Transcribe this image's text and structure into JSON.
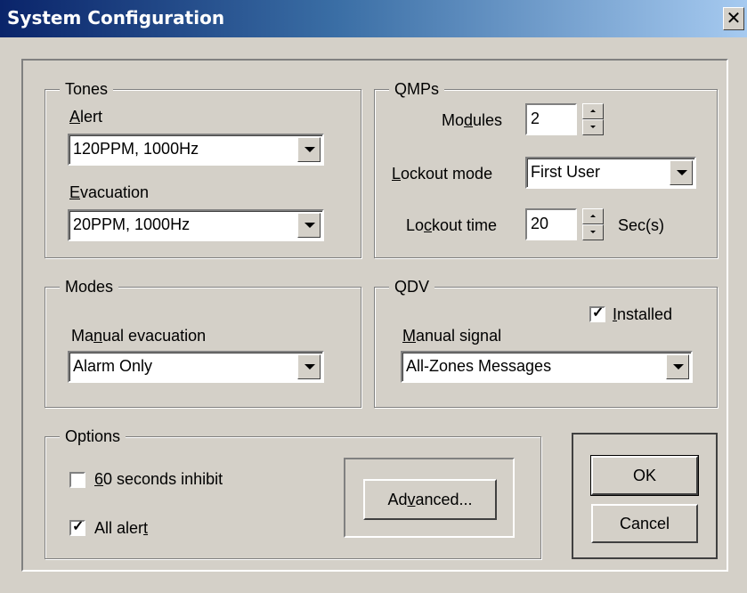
{
  "window": {
    "title": "System Configuration"
  },
  "tones": {
    "title": "Tones",
    "alert_label": "Alert",
    "alert_value": "120PPM, 1000Hz",
    "evacuation_label": "Evacuation",
    "evacuation_value": "20PPM, 1000Hz"
  },
  "qmps": {
    "title": "QMPs",
    "modules_label": "Modules",
    "modules_value": "2",
    "lockout_mode_label": "Lockout mode",
    "lockout_mode_value": "First User",
    "lockout_time_label": "Lockout time",
    "lockout_time_value": "20",
    "lockout_time_unit": "Sec(s)"
  },
  "modes": {
    "title": "Modes",
    "manual_evacuation_label": "Manual evacuation",
    "manual_evacuation_value": "Alarm Only"
  },
  "qdv": {
    "title": "QDV",
    "installed_label": "Installed",
    "installed_checked": true,
    "manual_signal_label": "Manual signal",
    "manual_signal_value": "All-Zones Messages"
  },
  "options": {
    "title": "Options",
    "inhibit_label": "60 seconds inhibit",
    "inhibit_checked": false,
    "all_alert_label": "All alert",
    "all_alert_checked": true,
    "advanced_label": "Advanced..."
  },
  "buttons": {
    "ok": "OK",
    "cancel": "Cancel"
  },
  "icons": {
    "close": "close-icon",
    "dropdown": "chevron-down-icon",
    "spin_up": "spin-up-icon",
    "spin_down": "spin-down-icon",
    "check": "checkmark-icon"
  },
  "colors": {
    "titlebar_start": "#0a246a",
    "titlebar_end": "#a6caf0",
    "face": "#d4d0c8"
  }
}
